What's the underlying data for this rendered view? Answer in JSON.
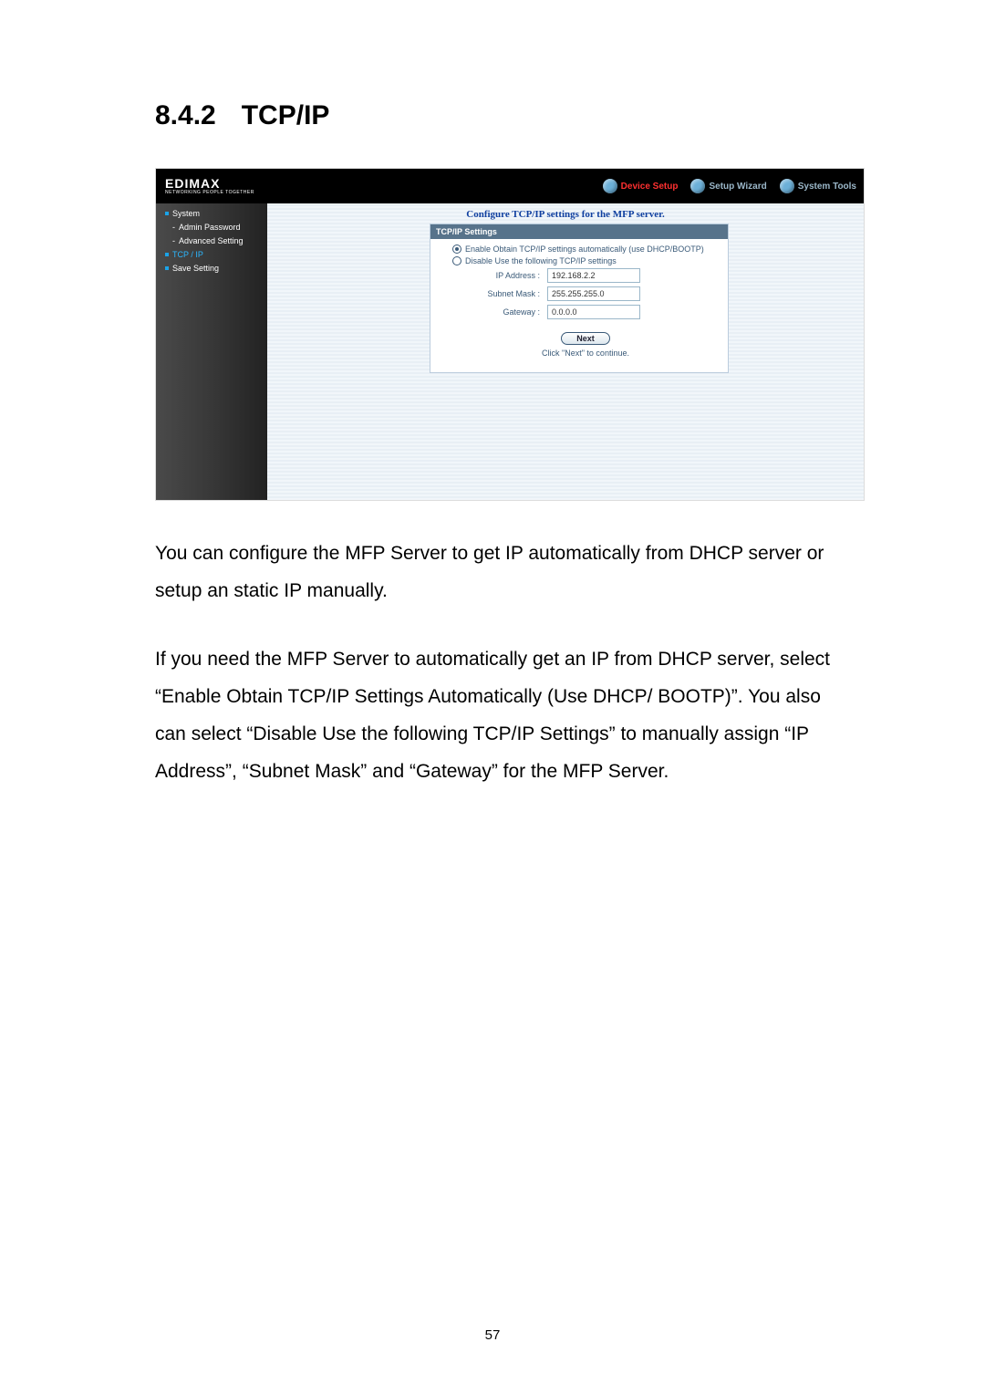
{
  "heading": {
    "number": "8.4.2",
    "title": "TCP/IP"
  },
  "logo": {
    "brand": "EDIMAX",
    "tagline": "NETWORKING PEOPLE TOGETHER"
  },
  "topnav": {
    "device_setup": "Device Setup",
    "setup_wizard": "Setup Wizard",
    "system_tools": "System Tools"
  },
  "sidebar": {
    "system": "System",
    "admin_password": "Admin Password",
    "advanced_setting": "Advanced Setting",
    "tcpip": "TCP / IP",
    "save_setting": "Save Setting"
  },
  "main": {
    "title": "Configure TCP/IP settings for the MFP server.",
    "panel_head": "TCP/IP Settings",
    "radio_enable": "Enable Obtain TCP/IP settings automatically (use DHCP/BOOTP)",
    "radio_disable": "Disable Use the following TCP/IP settings",
    "fields": {
      "ip_label": "IP Address :",
      "ip_value": "192.168.2.2",
      "subnet_label": "Subnet Mask :",
      "subnet_value": "255.255.255.0",
      "gateway_label": "Gateway :",
      "gateway_value": "0.0.0.0"
    },
    "next_label": "Next",
    "next_hint": "Click \"Next\" to continue."
  },
  "paragraphs": {
    "p1": "You can configure the MFP Server to get IP automatically from DHCP server or setup an static IP manually.",
    "p2": "If you need the MFP Server to automatically get an IP from DHCP server, select “Enable Obtain TCP/IP Settings Automatically (Use DHCP/ BOOTP)”. You also can select “Disable Use the following TCP/IP Settings” to manually assign “IP Address”, “Subnet Mask” and “Gateway” for the MFP Server."
  },
  "page_number": "57"
}
